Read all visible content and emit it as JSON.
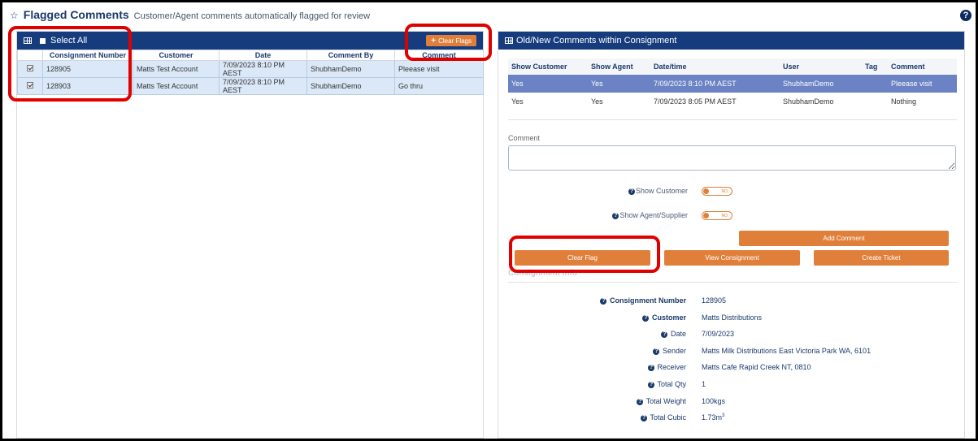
{
  "header": {
    "title": "Flagged Comments",
    "subtitle": "Customer/Agent comments automatically flagged for review",
    "help_glyph": "?"
  },
  "left_panel": {
    "select_all_label": "Select All",
    "clear_flags_label": "Clear Flags",
    "columns": [
      "Consignment Number",
      "Customer",
      "Date",
      "Comment By",
      "Comment"
    ],
    "rows": [
      {
        "checked": true,
        "consignment": "128905",
        "customer": "Matts Test Account",
        "date": "7/09/2023 8:10 PM AEST",
        "comment_by": "ShubhamDemo",
        "comment": "Pleease visit"
      },
      {
        "checked": true,
        "consignment": "128903",
        "customer": "Matts Test Account",
        "date": "7/09/2023 8:10 PM AEST",
        "comment_by": "ShubhamDemo",
        "comment": "Go thru"
      }
    ]
  },
  "right_panel": {
    "title": "Old/New Comments within Consignment",
    "columns": [
      "Show Customer",
      "Show Agent",
      "Date/time",
      "User",
      "Tag",
      "Comment"
    ],
    "rows": [
      {
        "selected": true,
        "show_customer": "Yes",
        "show_agent": "Yes",
        "datetime": "7/09/2023 8:10 PM AEST",
        "user": "ShubhamDemo",
        "tag": "",
        "comment": "Pleease visit"
      },
      {
        "selected": false,
        "show_customer": "Yes",
        "show_agent": "Yes",
        "datetime": "7/09/2023 8:05 PM AEST",
        "user": "ShubhamDemo",
        "tag": "",
        "comment": "Nothing"
      }
    ],
    "comment_label": "Comment",
    "comment_value": "",
    "show_customer_label": "Show Customer",
    "show_customer_toggle": "NO",
    "show_agent_label": "Show Agent/Supplier",
    "show_agent_toggle": "NO",
    "add_comment_label": "Add Comment",
    "clear_flag_label": "Clear Flag",
    "view_consignment_label": "View Consignment",
    "create_ticket_label": "Create Ticket",
    "info_section_peek": "Consignment Info",
    "info": {
      "consignment_number_label": "Consignment Number",
      "consignment_number": "128905",
      "customer_label": "Customer",
      "customer": "Matts Distributions",
      "date_label": "Date",
      "date": "7/09/2023",
      "sender_label": "Sender",
      "sender": "Matts Milk Distributions East Victoria Park WA, 6101",
      "receiver_label": "Receiver",
      "receiver": "Matts Cafe Rapid Creek NT, 0810",
      "total_qty_label": "Total Qty",
      "total_qty": "1",
      "total_weight_label": "Total Weight",
      "total_weight": "100kgs",
      "total_cubic_label": "Total Cubic",
      "total_cubic": "1.73m",
      "total_cubic_sup": "3"
    }
  },
  "colors": {
    "panel_header": "#163c7d",
    "accent_orange": "#e07f3a",
    "selected_row": "#6b82c4",
    "highlight_red": "#e00000"
  }
}
